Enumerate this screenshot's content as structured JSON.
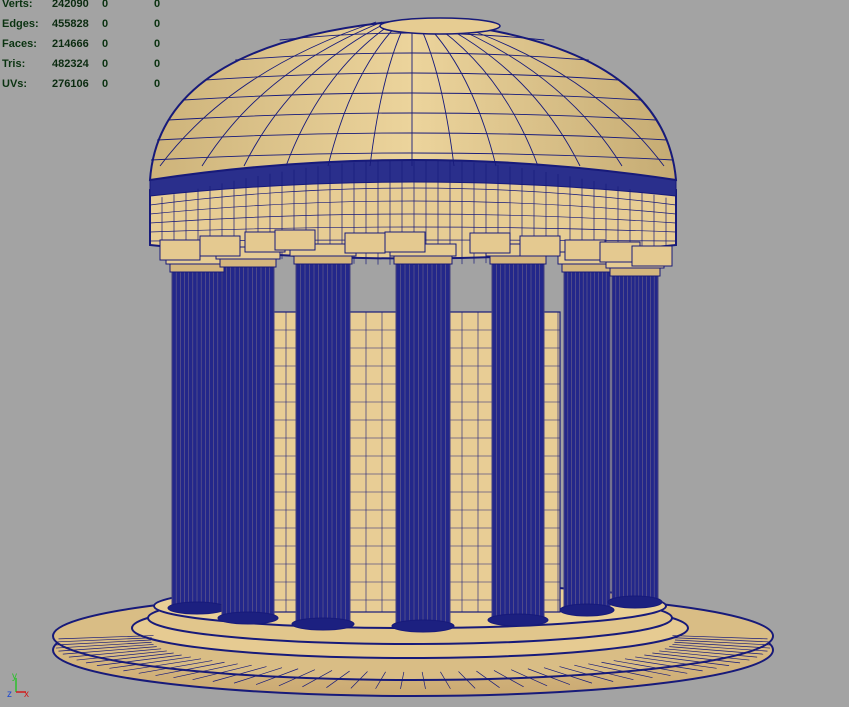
{
  "hud": {
    "rows": [
      {
        "label": "Verts:",
        "total": "242090",
        "selected": "0",
        "highlighted": "0"
      },
      {
        "label": "Edges:",
        "total": "455828",
        "selected": "0",
        "highlighted": "0"
      },
      {
        "label": "Faces:",
        "total": "214666",
        "selected": "0",
        "highlighted": "0"
      },
      {
        "label": "Tris:",
        "total": "482324",
        "selected": "0",
        "highlighted": "0"
      },
      {
        "label": "UVs:",
        "total": "276106",
        "selected": "0",
        "highlighted": "0"
      }
    ]
  },
  "axis": {
    "y": "y",
    "z": "z",
    "x": "x"
  },
  "colors": {
    "background": "#a3a3a3",
    "surface": "#e9cf95",
    "wireframe": "#171a7a",
    "hud_text": "#0b3311",
    "axis_x": "#d11c1c",
    "axis_y": "#2cc02c",
    "axis_z": "#1c48d1"
  }
}
